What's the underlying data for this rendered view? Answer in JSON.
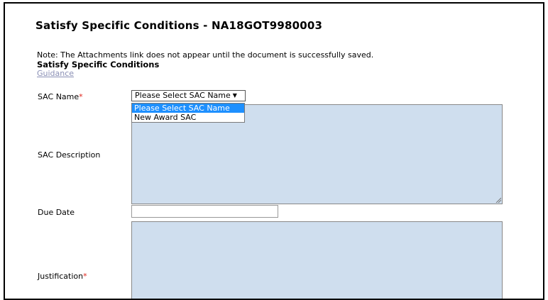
{
  "page": {
    "title": "Satisfy Specific Conditions - NA18GOT9980003",
    "note": "Note: The Attachments link does not appear until the document is successfully saved.",
    "section_heading": "Satisfy Specific Conditions",
    "guidance_link": "Guidance"
  },
  "form": {
    "sac_name": {
      "label": "SAC Name",
      "required_marker": "*",
      "selected_value": "Please Select SAC Name",
      "options": [
        "Please Select SAC Name",
        "New Award SAC"
      ],
      "dropdown_open": true
    },
    "sac_description": {
      "label": "SAC Description",
      "value": ""
    },
    "due_date": {
      "label": "Due Date",
      "value": ""
    },
    "justification": {
      "label": "Justification",
      "required_marker": "*",
      "value": ""
    }
  },
  "icons": {
    "dropdown_arrow": "caret-down-icon",
    "resize_grip": "resize-grip-icon"
  },
  "colors": {
    "textarea_background": "#cfdeee",
    "required_marker": "#e0241b",
    "link": "#8a8fb5",
    "dropdown_highlight": "#1e90ff"
  }
}
